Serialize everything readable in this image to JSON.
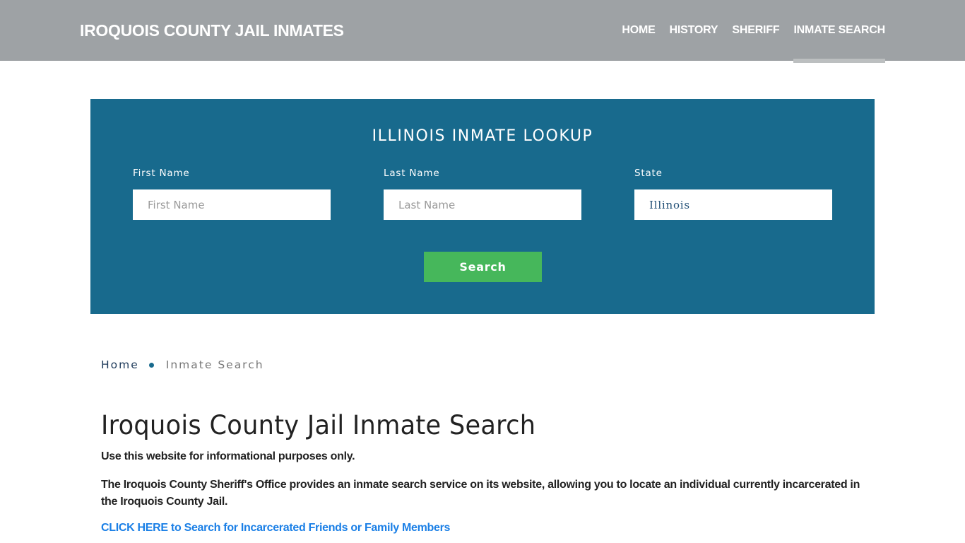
{
  "header": {
    "brand": "IROQUOIS COUNTY JAIL INMATES",
    "nav": [
      {
        "label": "HOME",
        "active": false
      },
      {
        "label": "HISTORY",
        "active": false
      },
      {
        "label": "SHERIFF",
        "active": false
      },
      {
        "label": "INMATE SEARCH",
        "active": true
      }
    ]
  },
  "lookup": {
    "title": "ILLINOIS INMATE LOOKUP",
    "first_name": {
      "label": "First Name",
      "placeholder": "First Name",
      "value": ""
    },
    "last_name": {
      "label": "Last Name",
      "placeholder": "Last Name",
      "value": ""
    },
    "state": {
      "label": "State",
      "value": "Illinois"
    },
    "search_label": "Search",
    "colors": {
      "panel": "#186a8d",
      "button": "#46b75b"
    }
  },
  "breadcrumb": {
    "home": "Home",
    "current": "Inmate Search"
  },
  "content": {
    "title": "Iroquois County Jail Inmate Search",
    "paragraph1": "Use this website for informational purposes only.",
    "paragraph2": "The Iroquois County Sheriff's Office provides an inmate search service on its website, allowing you to locate an individual currently incarcerated in the Iroquois County Jail.",
    "cta": "CLICK HERE to Search for Incarcerated Friends or Family Members"
  }
}
